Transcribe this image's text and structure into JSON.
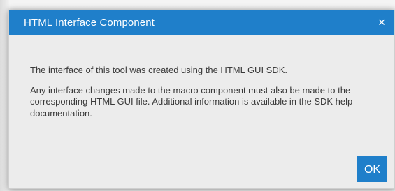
{
  "dialog": {
    "title": "HTML Interface Component",
    "close_symbol": "×",
    "paragraphs": [
      "The interface of this tool was created using the HTML GUI SDK.",
      "Any interface changes made to the macro component must also be made to the corresponding HTML GUI file. Additional information is available in the SDK help documentation."
    ],
    "ok_label": "OK"
  },
  "colors": {
    "accent": "#1f7fca",
    "dialog_background": "#ececec",
    "text": "#3a3a3a"
  },
  "icons": {
    "close": "close-icon"
  }
}
